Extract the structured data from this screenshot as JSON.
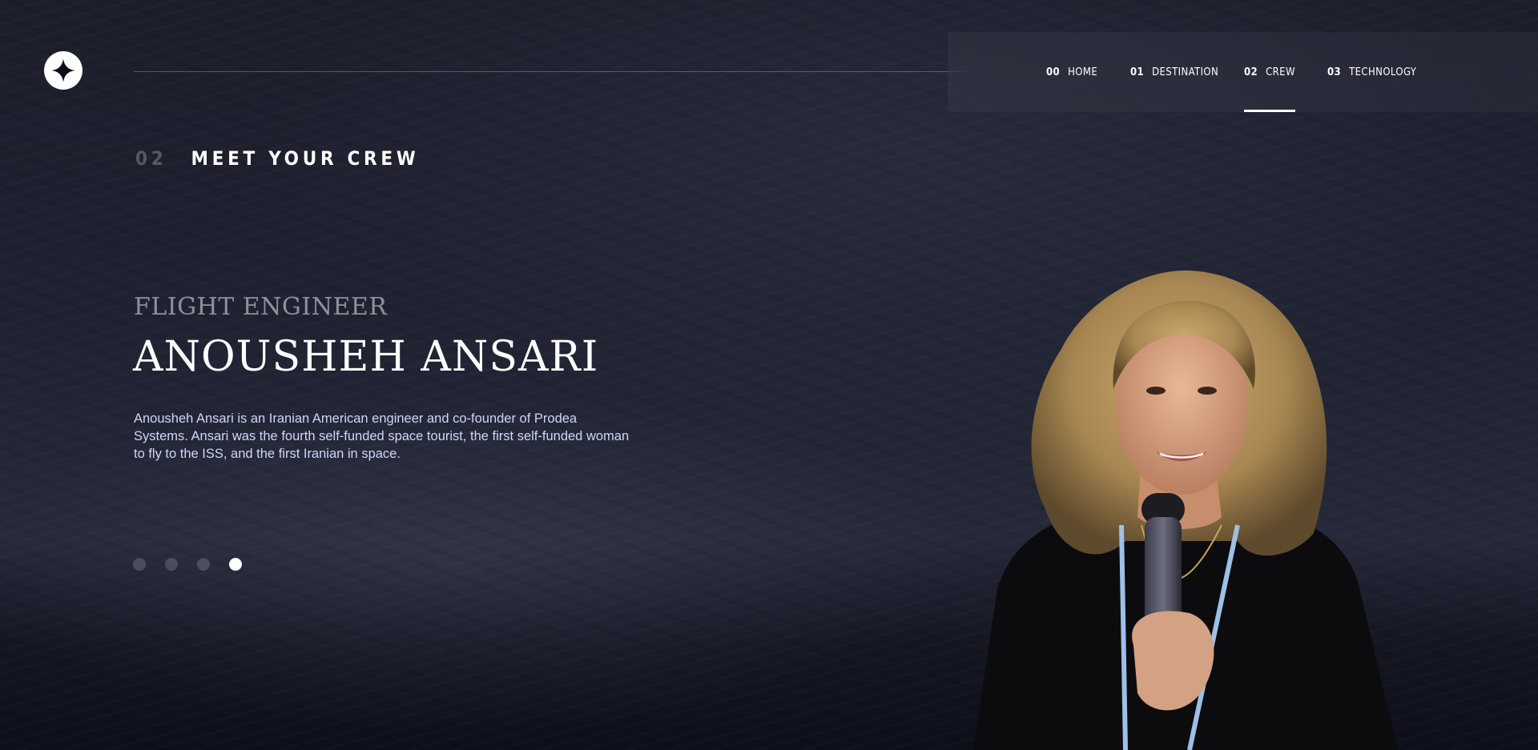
{
  "header": {
    "logo_icon": "star-logo-icon",
    "nav": [
      {
        "num": "00",
        "label": "HOME",
        "active": false
      },
      {
        "num": "01",
        "label": "DESTINATION",
        "active": false
      },
      {
        "num": "02",
        "label": "CREW",
        "active": true
      },
      {
        "num": "03",
        "label": "TECHNOLOGY",
        "active": false
      }
    ]
  },
  "section": {
    "num": "02",
    "title": "MEET YOUR CREW"
  },
  "crew": {
    "role": "FLIGHT ENGINEER",
    "name": "ANOUSHEH ANSARI",
    "bio": "Anousheh Ansari is an Iranian American engineer and co-founder of Prodea Systems. Ansari was the fourth self-funded space tourist, the first self-funded woman to fly to the ISS, and the first Iranian in space.",
    "slide_count": 4,
    "active_slide": 4,
    "portrait_icon": "crew-portrait-image"
  },
  "colors": {
    "background": "#0b0d17",
    "text": "#ffffff",
    "body_text": "#d0d6f9"
  }
}
